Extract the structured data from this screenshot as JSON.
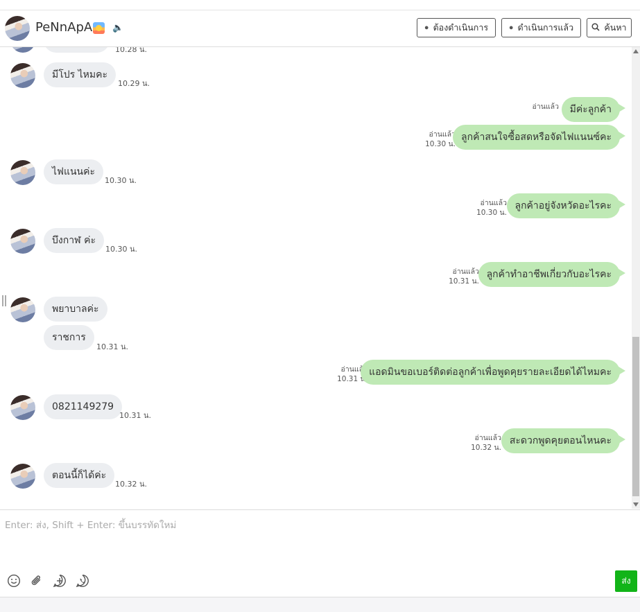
{
  "header": {
    "contact_name": "PeNnApA",
    "btn_pending": "ต้องดำเนินการ",
    "btn_done": "ดำเนินการแล้ว",
    "btn_search": "ค้นหา"
  },
  "messages": [
    {
      "dir": "in",
      "text": "",
      "time": "10.28 น."
    },
    {
      "dir": "in",
      "text": "มีโปร ไหมคะ",
      "time": "10.29 น."
    },
    {
      "dir": "out",
      "text": "มีค่ะลูกค้า",
      "read": "อ่านแล้ว",
      "time": ""
    },
    {
      "dir": "out",
      "text": "ลูกค้าสนใจซื้อสดหรือจัดไฟแนนซ์คะ",
      "read": "อ่านแล้ว",
      "time": "10.30 น."
    },
    {
      "dir": "in",
      "text": "ไฟแนนค่ะ",
      "time": "10.30 น."
    },
    {
      "dir": "out",
      "text": "ลูกค้าอยู่จังหวัดอะไรคะ",
      "read": "อ่านแล้ว",
      "time": "10.30 น."
    },
    {
      "dir": "in",
      "text": "บึงกาฬ ค่ะ",
      "time": "10.30 น."
    },
    {
      "dir": "out",
      "text": "ลูกค้าทำอาชีพเกี่ยวกับอะไรคะ",
      "read": "อ่านแล้ว",
      "time": "10.31 น."
    },
    {
      "dir": "in",
      "text": "พยาบาลค่ะ",
      "time": ""
    },
    {
      "dir": "in",
      "text": "ราชการ",
      "time": "10.31 น."
    },
    {
      "dir": "out",
      "text": "แอดมินขอเบอร์ติดต่อลูกค้าเพื่อพูดคุยรายละเอียดได้ไหมคะ",
      "read": "อ่านแล้ว",
      "time": "10.31 น."
    },
    {
      "dir": "in",
      "text": "0821149279",
      "time": "10.31 น."
    },
    {
      "dir": "out",
      "text": "สะดวกพูดคุยตอนไหนคะ",
      "read": "อ่านแล้ว",
      "time": "10.32 น."
    },
    {
      "dir": "in",
      "text": "ตอนนี้ก็ได้ค่ะ",
      "time": "10.32 น."
    }
  ],
  "composer": {
    "placeholder": "Enter: ส่ง, Shift + Enter: ขึ้นบรรทัดใหม่",
    "send_label": "ส่ง"
  },
  "icons": [
    "avatar",
    "sunrise-emoji-icon",
    "speaker-icon",
    "chat-bubble-icon",
    "chat-check-icon",
    "search-icon",
    "emoji-icon",
    "paperclip-icon",
    "add-icon",
    "whatsapp-icon"
  ],
  "colors": {
    "outgoing_bubble": "#bfe9b5",
    "incoming_bubble": "#eceef1",
    "send_button": "#12b418"
  }
}
